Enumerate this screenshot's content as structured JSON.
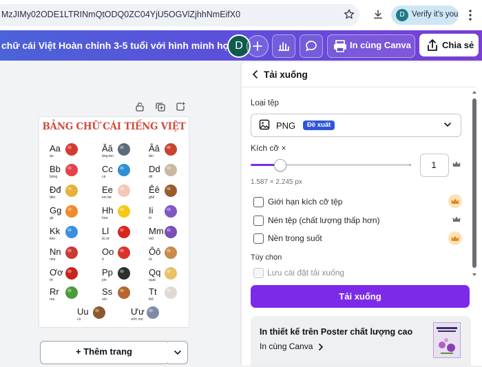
{
  "browser": {
    "url": "MzJIMy02ODE1LTRINmQtODQ0ZC04YjU5OGVlZjhhNmEifX0",
    "profile_initial": "D",
    "verify_label": "Verify it's you"
  },
  "header": {
    "doc_title": "chữ cái Việt Hoàn chỉnh 3-5 tuổi với hình minh họa s...",
    "avatar_initial": "D",
    "print_label": "In cùng Canva",
    "share_label": "Chia sẻ"
  },
  "canvas": {
    "poster_title": "BẢNG CHỮ CÁI TIẾNG VIỆT",
    "letters": [
      {
        "letter": "Aa",
        "word": "áo",
        "pic": "shirt"
      },
      {
        "letter": "Ăă",
        "word": "ăng-ten",
        "pic": "tv"
      },
      {
        "letter": "Ââ",
        "word": "ấm",
        "pic": "kettle"
      },
      {
        "letter": "Bb",
        "word": "bóng",
        "pic": "balloon"
      },
      {
        "letter": "Cc",
        "word": "cá",
        "pic": "fish"
      },
      {
        "letter": "Dd",
        "word": "dê",
        "pic": "goat"
      },
      {
        "letter": "Đđ",
        "word": "đèn",
        "pic": "lamp"
      },
      {
        "letter": "Ee",
        "word": "em bé",
        "pic": "baby"
      },
      {
        "letter": "Êê",
        "word": "ghế",
        "pic": "chair"
      },
      {
        "letter": "Gg",
        "word": "gà",
        "pic": "chicken"
      },
      {
        "letter": "Hh",
        "word": "hoa",
        "pic": "flower"
      },
      {
        "letter": "Ii",
        "word": "bi",
        "pic": "marbles"
      },
      {
        "letter": "Kk",
        "word": "kéo",
        "pic": "scissors"
      },
      {
        "letter": "Ll",
        "word": "lá cờ",
        "pic": "flag"
      },
      {
        "letter": "Mm",
        "word": "mũ",
        "pic": "hat"
      },
      {
        "letter": "Nn",
        "word": "nhà",
        "pic": "house"
      },
      {
        "letter": "Oo",
        "word": "ô",
        "pic": "umbrella"
      },
      {
        "letter": "Ôô",
        "word": "ốc",
        "pic": "snail"
      },
      {
        "letter": "Ơơ",
        "word": "ớt",
        "pic": "chili"
      },
      {
        "letter": "Pp",
        "word": "pin",
        "pic": "battery"
      },
      {
        "letter": "Qq",
        "word": "quạt",
        "pic": "fan"
      },
      {
        "letter": "Rr",
        "word": "rùa",
        "pic": "turtle"
      },
      {
        "letter": "Ss",
        "word": "sóc",
        "pic": "squirrel"
      },
      {
        "letter": "Tt",
        "word": "thỏ",
        "pic": "rabbit"
      },
      {
        "letter": "Uu",
        "word": "cú",
        "pic": "owl"
      },
      {
        "letter": "Ưư",
        "word": "ước mơ",
        "pic": "dream"
      }
    ],
    "add_page_label": "+ Thêm trang"
  },
  "panel": {
    "title": "Tải xuống",
    "filetype_label": "Loại tệp",
    "filetype_value": "PNG",
    "recommended_badge": "Đề xuất",
    "size_label": "Kích cỡ ×",
    "size_value": "1",
    "size_fraction": 0.18,
    "dimensions": "1.587 × 2.245 px",
    "options": [
      {
        "label": "Giới hạn kích cỡ tệp",
        "checked": false
      },
      {
        "label": "Nén tệp (chất lượng thấp hơn)",
        "checked": false
      },
      {
        "label": "Nền trong suốt",
        "checked": false
      }
    ],
    "section_label": "Tùy chọn",
    "save_settings_label": "Lưu cài đặt tải xuống",
    "download_button": "Tải xuống",
    "promo_title": "In thiết kế trên Poster chất lượng cao",
    "promo_link": "In cùng Canva"
  },
  "colors": {
    "accent": "#7d2ae8",
    "badge": "#2f56d8",
    "header_start": "#4c62d9",
    "header_end": "#7a3fd4"
  }
}
